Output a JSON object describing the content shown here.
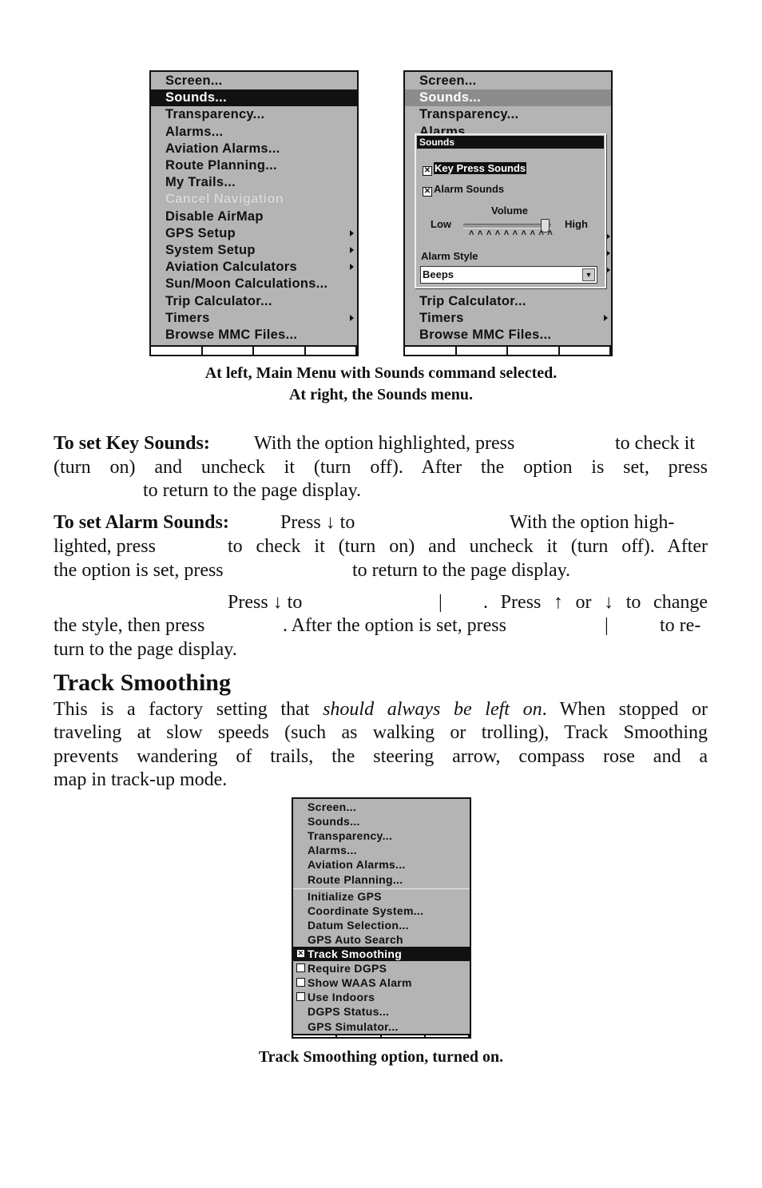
{
  "main_menu": {
    "items": [
      {
        "label": "Screen...",
        "state": "normal"
      },
      {
        "label": "Sounds...",
        "state": "selected"
      },
      {
        "label": "Transparency...",
        "state": "normal"
      },
      {
        "label": "Alarms...",
        "state": "normal"
      },
      {
        "label": "Aviation Alarms...",
        "state": "normal"
      },
      {
        "label": "Route Planning...",
        "state": "normal"
      },
      {
        "label": "My Trails...",
        "state": "normal"
      },
      {
        "label": "Cancel Navigation",
        "state": "disabled"
      },
      {
        "label": "Disable AirMap",
        "state": "normal"
      },
      {
        "label": "GPS Setup",
        "state": "normal",
        "submenu": true
      },
      {
        "label": "System Setup",
        "state": "normal",
        "submenu": true
      },
      {
        "label": "Aviation Calculators",
        "state": "normal",
        "submenu": true
      },
      {
        "label": "Sun/Moon Calculations...",
        "state": "normal"
      },
      {
        "label": "Trip Calculator...",
        "state": "normal"
      },
      {
        "label": "Timers",
        "state": "normal",
        "submenu": true
      },
      {
        "label": "Browse MMC Files...",
        "state": "normal"
      }
    ]
  },
  "sounds_menu_bg": {
    "top_items": [
      {
        "label": "Screen..."
      },
      {
        "label": "Sounds..."
      },
      {
        "label": "Transparency..."
      },
      {
        "label": "Alarms"
      }
    ],
    "bottom_items": [
      {
        "label": "Trip Calculator..."
      },
      {
        "label": "Timers",
        "submenu": true
      },
      {
        "label": "Browse MMC Files..."
      }
    ]
  },
  "sounds_dialog": {
    "title": "Sounds",
    "key_press_sounds": {
      "label": "Key Press Sounds",
      "checked": true
    },
    "alarm_sounds": {
      "label": "Alarm Sounds",
      "checked": true
    },
    "volume_label": "Volume",
    "low_label": "Low",
    "high_label": "High",
    "volume_level_percent": 95,
    "alarm_style_label": "Alarm Style",
    "alarm_style_value": "Beeps",
    "check_glyph": "✕"
  },
  "caption1_line1": "At left, Main Menu with Sounds command selected.",
  "caption1_line2": "At right, the Sounds menu.",
  "text": {
    "key_bold": "To set Key Sounds:",
    "key_a": "With the option highlighted, press",
    "key_b": "to check it",
    "key_l2": "(turn on) and uncheck it (turn off). After the option is set, press",
    "key_l3": "to return to the page display.",
    "alarm_bold": "To set Alarm Sounds:",
    "alarm_a": "Press ↓ to",
    "alarm_b": "With the option high-",
    "alarm_l2a": "lighted, press",
    "alarm_l2b": "to check it (turn on) and uncheck it (turn off). After",
    "alarm_l3a": "the option is set, press",
    "alarm_l3b": "to return to the page display.",
    "style_a": "Press ↓ to",
    "style_bar": "|",
    "style_b": ". Press ↑ or ↓ to change",
    "style_l2a": "the style, then press",
    "style_l2b": ". After the option is set, press",
    "style_l2bar": "|",
    "style_l2c": "to re-",
    "style_l3": "turn to the page display."
  },
  "section": {
    "heading": "Track Smoothing",
    "p1a": "This is a factory setting that ",
    "p1i": "should always be left on",
    "p1b": ". When stopped or",
    "p2": "traveling at slow speeds (such as walking or trolling), Track Smoothing",
    "p3": "prevents wandering of trails, the steering arrow, compass rose and a",
    "p4": "map in track-up mode."
  },
  "gps_menu": {
    "items": [
      {
        "label": "Screen..."
      },
      {
        "label": "Sounds..."
      },
      {
        "label": "Transparency..."
      },
      {
        "label": "Alarms..."
      },
      {
        "label": "Aviation Alarms..."
      },
      {
        "label": "Route Planning..."
      },
      {
        "label": "Initialize GPS"
      },
      {
        "label": "Coordinate System..."
      },
      {
        "label": "Datum Selection..."
      },
      {
        "label": "GPS Auto Search"
      },
      {
        "label": "Track Smoothing",
        "checkbox": true,
        "checked": true,
        "selected": true
      },
      {
        "label": "Require DGPS",
        "checkbox": true,
        "checked": false
      },
      {
        "label": "Show WAAS Alarm",
        "checkbox": true,
        "checked": false
      },
      {
        "label": "Use Indoors",
        "checkbox": true,
        "checked": false
      },
      {
        "label": "DGPS Status..."
      },
      {
        "label": "GPS Simulator..."
      }
    ]
  },
  "caption2": "Track Smoothing option, turned on."
}
